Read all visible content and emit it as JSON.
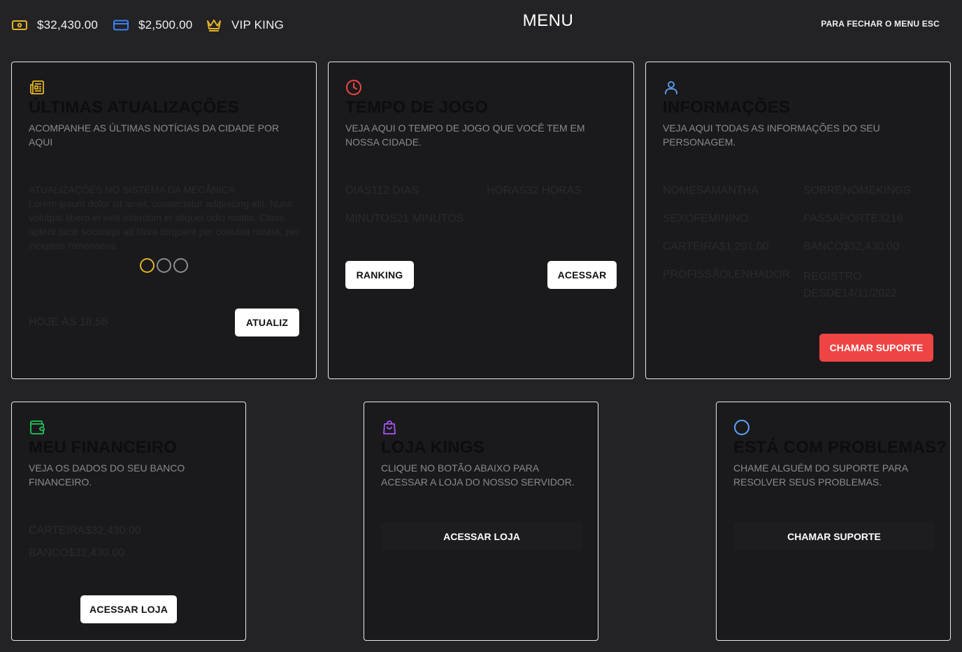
{
  "topbar": {
    "cash": "$32,430.00",
    "bank": "$2,500.00",
    "vip": "VIP KING",
    "title": "MENU",
    "close_hint": "PARA FECHAR O MENU ESC"
  },
  "colors": {
    "cash_icon": "#e5b324",
    "bank_icon": "#3b82f6",
    "vip_icon": "#e5b324",
    "news_icon": "#e5b324",
    "clock_icon": "#ef4444",
    "user_icon": "#60a5fa",
    "wallet_icon": "#22c55e",
    "bag_icon": "#a855f7",
    "help_icon": "#60a5fa",
    "danger": "#ef4444"
  },
  "news": {
    "icon": "newspaper-icon",
    "title": "ÚLTIMAS ATUALIZAÇÕES",
    "subtitle": "ACOMPANHE AS ÚLTIMAS NOTÍCIAS DA CIDADE POR AQUI",
    "item_title": "ATUALIZAÇÕES NO SISTEMA DA MECÂNICA",
    "item_body": "Lorem ipsum dolor sit amet, consectetur adipiscing elit. Nunc volutpat libero et velit interdum et aliquet odio mattis. Class aptent taciti sociosqu ad litora torquent per conubia nostra, per inceptos himenaeos.",
    "date": "HOJE ÀS 18:56",
    "button": "ATUALIZ"
  },
  "playtime": {
    "icon": "clock-icon",
    "title": "TEMPO DE JOGO",
    "subtitle": "VEJA AQUI O TEMPO DE JOGO QUE VOCÊ TEM EM NOSSA CIDADE.",
    "days": "DIAS112 DIAS",
    "hours": "HORAS32 HORAS",
    "minutes": "MINUTOS21 MINUTOS",
    "ranking_button": "RANKING",
    "access_button": "ACESSAR"
  },
  "info": {
    "icon": "user-icon",
    "title": "INFORMAÇÕES",
    "subtitle": "VEJA AQUI TODAS AS INFORMAÇÕES DO SEU PERSONAGEM.",
    "fields": [
      "NOMESAMANTHA",
      "SOBRENOMEKINGS",
      "SEXOFEMININO",
      "PASSAPORTE3216",
      "CARTEIRA$1,291.00",
      "BANCO$32,430.00",
      "PROFISSÃOLENHADOR",
      "REGISTRO DESDE14/11/2022"
    ],
    "support_button": "CHAMAR SUPORTE"
  },
  "finance": {
    "icon": "wallet-icon",
    "title": "MEU FINANCEIRO",
    "subtitle": "VEJA OS DADOS DO SEU BANCO FINANCEIRO.",
    "wallet": "CARTEIRA$32,430.00",
    "bank": "BANCO$32,430.00",
    "button": "ACESSAR LOJA"
  },
  "shop": {
    "icon": "shopping-bag-icon",
    "title": "LOJA KINGS",
    "subtitle": "CLIQUE NO BOTÃO ABAIXO PARA ACESSAR A LOJA DO NOSSO SERVIDOR.",
    "button": "ACESSAR LOJA"
  },
  "help": {
    "icon": "help-circle-icon",
    "title": "ESTÁ COM PROBLEMAS?",
    "subtitle": "CHAME ALGUÉM DO SUPORTE PARA RESOLVER SEUS PROBLEMAS.",
    "button": "CHAMAR SUPORTE"
  }
}
